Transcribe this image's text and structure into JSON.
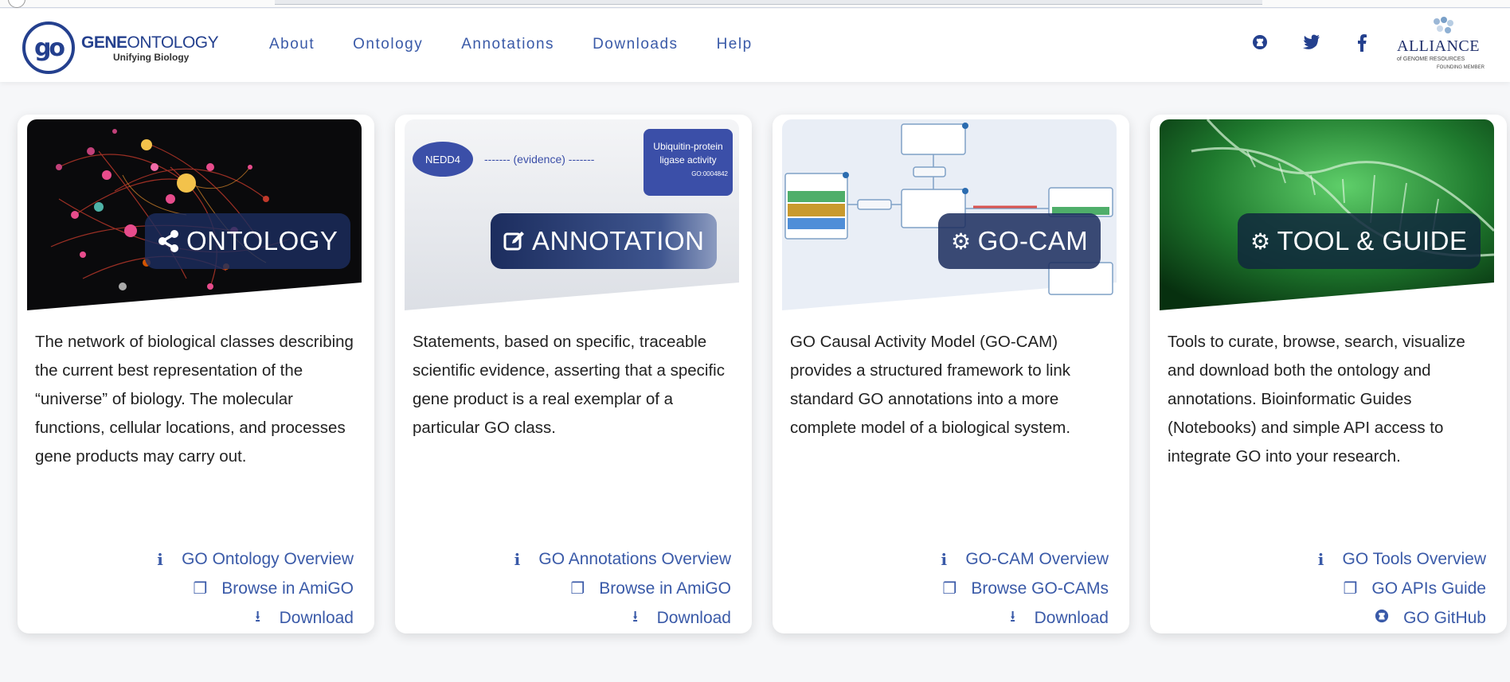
{
  "header": {
    "logo": {
      "title_bold": "GENE",
      "title_light": "ONTOLOGY",
      "subtitle": "Unifying Biology",
      "mark": "go"
    },
    "nav": [
      "About",
      "Ontology",
      "Annotations",
      "Downloads",
      "Help"
    ],
    "social_icons": [
      "github-icon",
      "twitter-icon",
      "facebook-icon"
    ],
    "alliance": {
      "title": "ALLIANCE",
      "line1": "of GENOME RESOURCES",
      "line2": "FOUNDING MEMBER"
    }
  },
  "colors": {
    "brand": "#24408e",
    "link": "#3a5aa8",
    "badge": "#1c2d5e"
  },
  "cards": [
    {
      "badge": "ONTOLOGY",
      "badge_icon": "share-icon",
      "description": "The network of biological classes describing the current best representation of the “universe” of biology. The molecular functions, cellular locations, and processes gene products may carry out.",
      "links": [
        {
          "icon": "info-icon",
          "label": "GO Ontology Overview"
        },
        {
          "icon": "copy-icon",
          "label": "Browse in AmiGO"
        },
        {
          "icon": "download-icon",
          "label": "Download"
        }
      ]
    },
    {
      "badge": "ANNOTATION",
      "badge_icon": "edit-icon",
      "image_text": {
        "node_left": "NEDD4",
        "edge": "------- (evidence) -------",
        "node_right_line1": "Ubiquitin-protein",
        "node_right_line2": "ligase activity",
        "node_right_id": "GO:0004842"
      },
      "description": "Statements, based on specific, traceable scientific evidence, asserting that a specific gene product is a real exemplar of a particular GO class.",
      "links": [
        {
          "icon": "info-icon",
          "label": "GO Annotations Overview"
        },
        {
          "icon": "copy-icon",
          "label": "Browse in AmiGO"
        },
        {
          "icon": "download-icon",
          "label": "Download"
        }
      ]
    },
    {
      "badge": "GO-CAM",
      "badge_icon": "gear-icon",
      "description": "GO Causal Activity Model (GO-CAM) provides a structured framework to link standard GO annotations into a more complete model of a biological system.",
      "links": [
        {
          "icon": "info-icon",
          "label": "GO-CAM Overview"
        },
        {
          "icon": "copy-icon",
          "label": "Browse GO-CAMs"
        },
        {
          "icon": "download-icon",
          "label": "Download"
        }
      ]
    },
    {
      "badge": "TOOL & GUIDE",
      "badge_icon": "gear-icon",
      "description": "Tools to curate, browse, search, visualize and download both the ontology and annotations. Bioinformatic Guides (Notebooks) and simple API access to integrate GO into your research.",
      "links": [
        {
          "icon": "info-icon",
          "label": "GO Tools Overview"
        },
        {
          "icon": "copy-icon",
          "label": "GO APIs Guide"
        },
        {
          "icon": "github-icon",
          "label": "GO GitHub"
        }
      ]
    }
  ]
}
